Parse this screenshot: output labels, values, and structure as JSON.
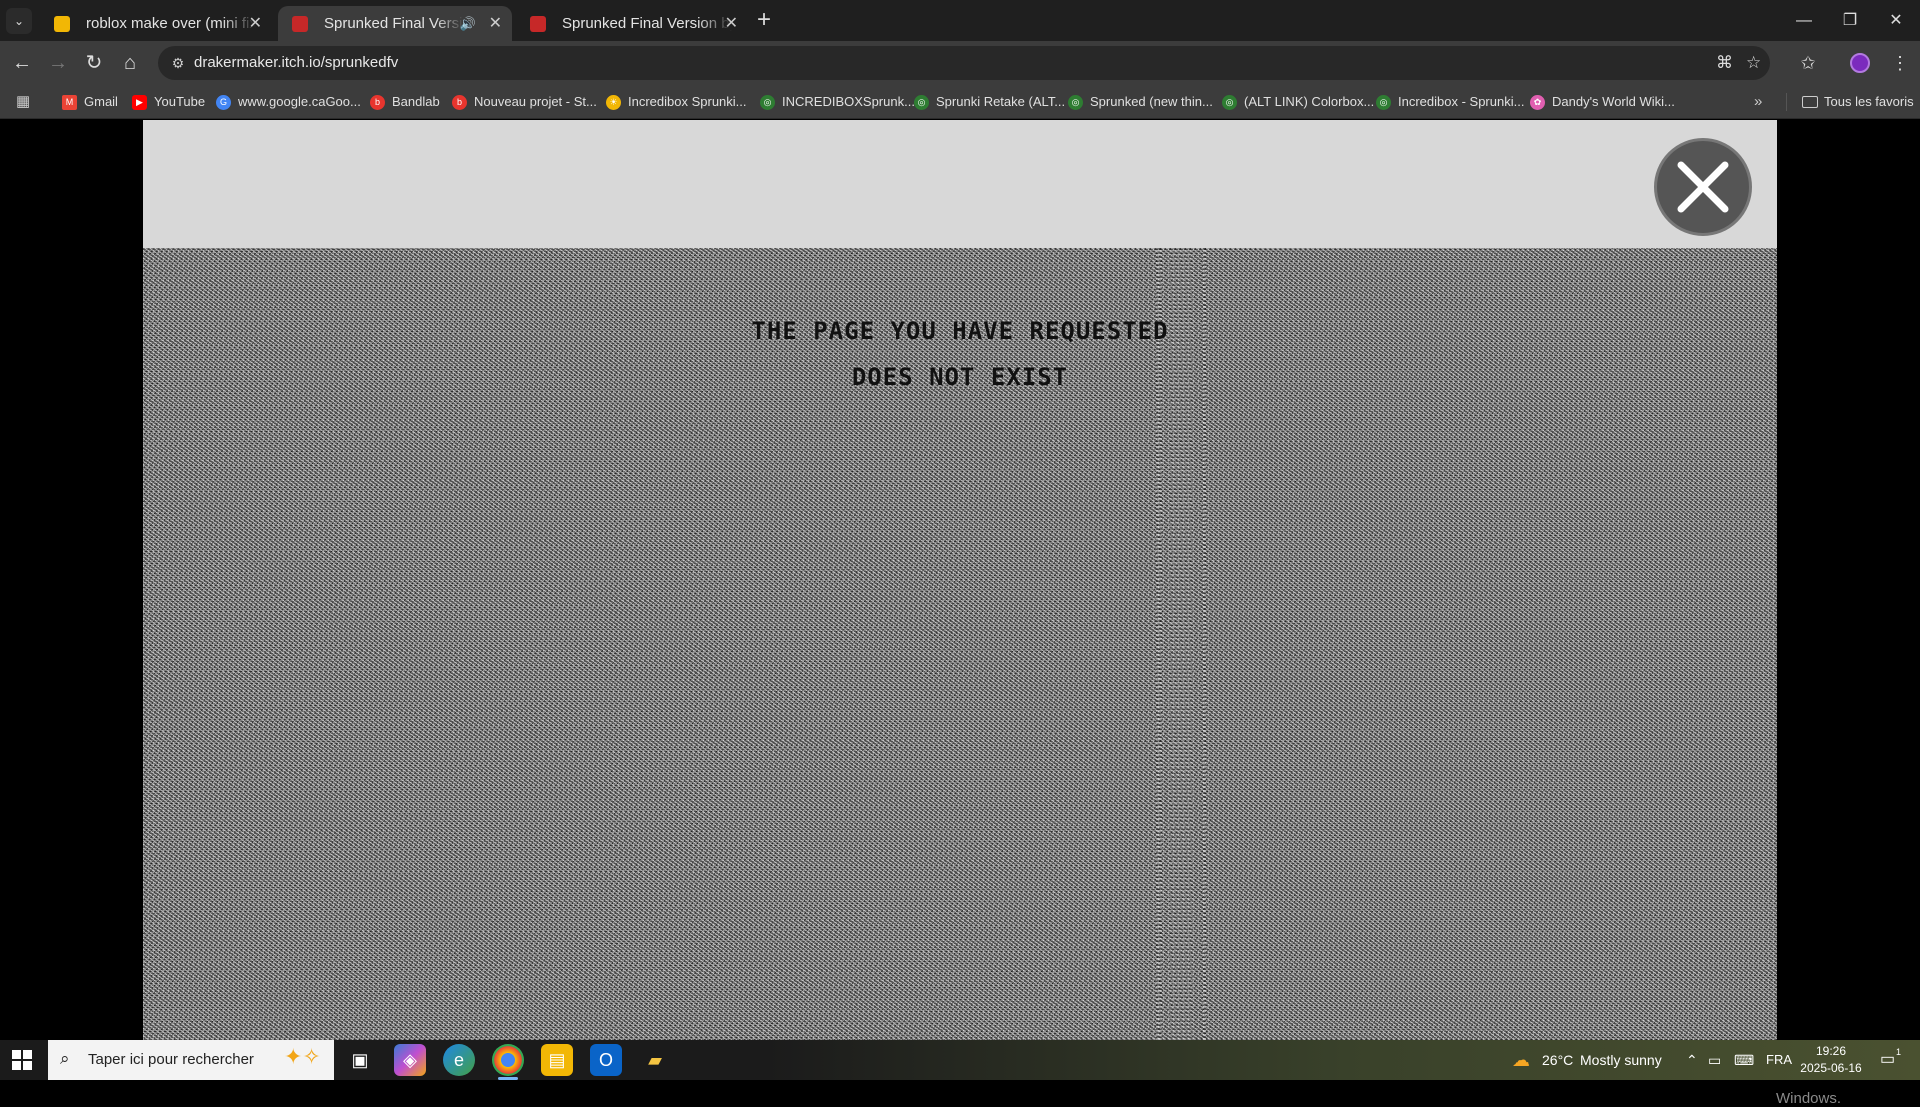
{
  "browser": {
    "tabs": [
      {
        "title": "roblox make over (mini fixes up",
        "active": false,
        "audio": false
      },
      {
        "title": "Sprunked Final Version by d",
        "active": true,
        "audio": true
      },
      {
        "title": "Sprunked Final Version by drak",
        "active": false,
        "audio": false
      }
    ],
    "url": "drakermaker.itch.io/sprunkedfv",
    "bookmarks": [
      {
        "label": "Gmail",
        "color": "#ea4335"
      },
      {
        "label": "YouTube",
        "color": "#ff0000"
      },
      {
        "label": "www.google.caGoo...",
        "color": "#4285f4"
      },
      {
        "label": "Bandlab",
        "color": "#e8352e"
      },
      {
        "label": "Nouveau projet - St...",
        "color": "#e8352e"
      },
      {
        "label": "Incredibox Sprunki...",
        "color": "#f2b705"
      },
      {
        "label": "INCREDIBOXSprunk...",
        "color": "#2e7d32"
      },
      {
        "label": "Sprunki Retake (ALT...",
        "color": "#2e7d32"
      },
      {
        "label": "Sprunked (new thin...",
        "color": "#2e7d32"
      },
      {
        "label": "(ALT LINK) Colorbox...",
        "color": "#2e7d32"
      },
      {
        "label": "Incredibox - Sprunki...",
        "color": "#2e7d32"
      },
      {
        "label": "Dandy's World Wiki...",
        "color": "#e05fb0"
      }
    ],
    "bookmarks_folder": "Tous les favoris"
  },
  "page": {
    "error_line1": "THE PAGE YOU HAVE REQUESTED",
    "error_line2": "DOES NOT EXIST",
    "watermark": "Windows."
  },
  "taskbar": {
    "search_placeholder": "Taper ici pour rechercher",
    "weather_temp": "26°C",
    "weather_text": "Mostly sunny",
    "language": "FRA",
    "time": "19:26",
    "date": "2025-06-16",
    "notification_count": "1"
  },
  "colors": {
    "header_bg": "#d8d8d8",
    "close_button_bg": "#555555",
    "chrome_dark": "#1f1f1f",
    "chrome_toolbar": "#3c3c3c"
  }
}
